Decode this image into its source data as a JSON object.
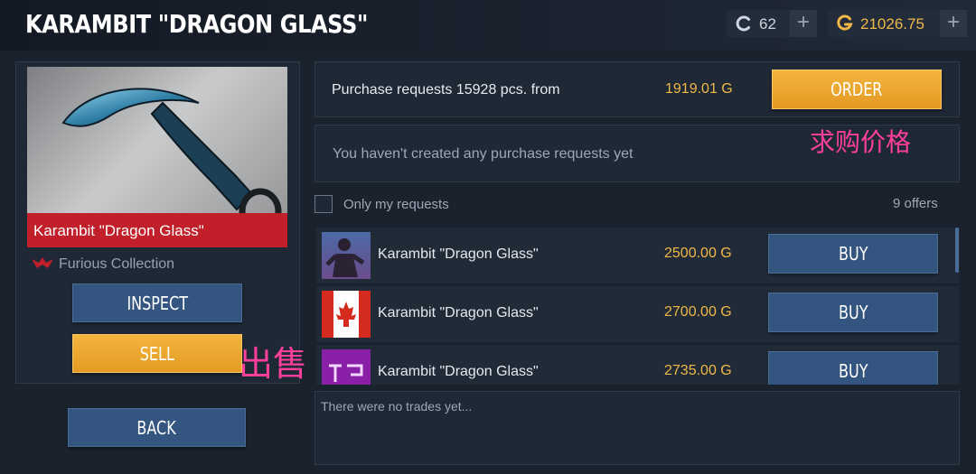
{
  "header": {
    "title": "KARAMBIT \"DRAGON GLASS\""
  },
  "currency": {
    "credits": {
      "value": "62",
      "icon": "credits-icon",
      "plus": "+"
    },
    "gold": {
      "value": "21026.75",
      "icon": "gold-icon",
      "plus": "+"
    }
  },
  "item": {
    "name": "Karambit \"Dragon Glass\"",
    "collection": "Furious Collection",
    "rarity_color": "#c1202b"
  },
  "left_buttons": {
    "inspect": "INSPECT",
    "sell": "SELL",
    "back": "BACK"
  },
  "purchase": {
    "summary": "Purchase requests 15928 pcs. from",
    "price": "1919.01 G",
    "order_label": "ORDER",
    "empty_message": "You haven't created any purchase requests yet"
  },
  "filter": {
    "only_mine_label": "Only my requests",
    "offers_count": "9 offers"
  },
  "offers": [
    {
      "name": "Karambit \"Dragon Glass\"",
      "price": "2500.00 G",
      "buy_label": "BUY",
      "avatar": "character-avatar"
    },
    {
      "name": "Karambit \"Dragon Glass\"",
      "price": "2700.00 G",
      "buy_label": "BUY",
      "avatar": "canada-flag-avatar"
    },
    {
      "name": "Karambit \"Dragon Glass\"",
      "price": "2735.00 G",
      "buy_label": "BUY",
      "avatar": "purple-logo-avatar"
    }
  ],
  "trades": {
    "empty_message": "There were no trades yet..."
  },
  "annotations": {
    "purchase_price": "求购价格",
    "sell": "出售"
  },
  "colors": {
    "accent_gold": "#f1b848",
    "button_blue": "#34557f",
    "annotation_pink": "#ff3f9c"
  }
}
